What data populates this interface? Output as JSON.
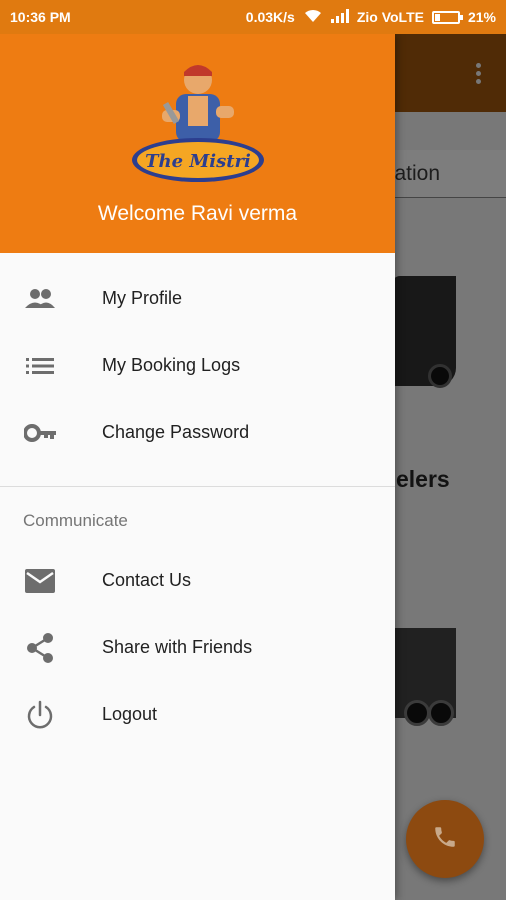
{
  "status_bar": {
    "time": "10:36 PM",
    "network_speed": "0.03K/s",
    "carrier": "Zio VoLTE",
    "battery": "21%",
    "battery_level": 0.21
  },
  "background": {
    "search_text": "sation",
    "section_heading": "elers"
  },
  "drawer": {
    "logo_text": "The Mistri",
    "welcome": "Welcome Ravi verma",
    "items": [
      {
        "label": "My Profile",
        "icon": "people-icon"
      },
      {
        "label": "My Booking Logs",
        "icon": "list-icon"
      },
      {
        "label": "Change Password",
        "icon": "key-icon"
      }
    ],
    "section_title": "Communicate",
    "communicate_items": [
      {
        "label": "Contact Us",
        "icon": "mail-icon"
      },
      {
        "label": "Share with Friends",
        "icon": "share-icon"
      },
      {
        "label": "Logout",
        "icon": "power-icon"
      }
    ]
  },
  "colors": {
    "primary": "#ee7c12",
    "status_bar": "#e07a10",
    "icon": "#6d6d6d",
    "text": "#212121"
  }
}
